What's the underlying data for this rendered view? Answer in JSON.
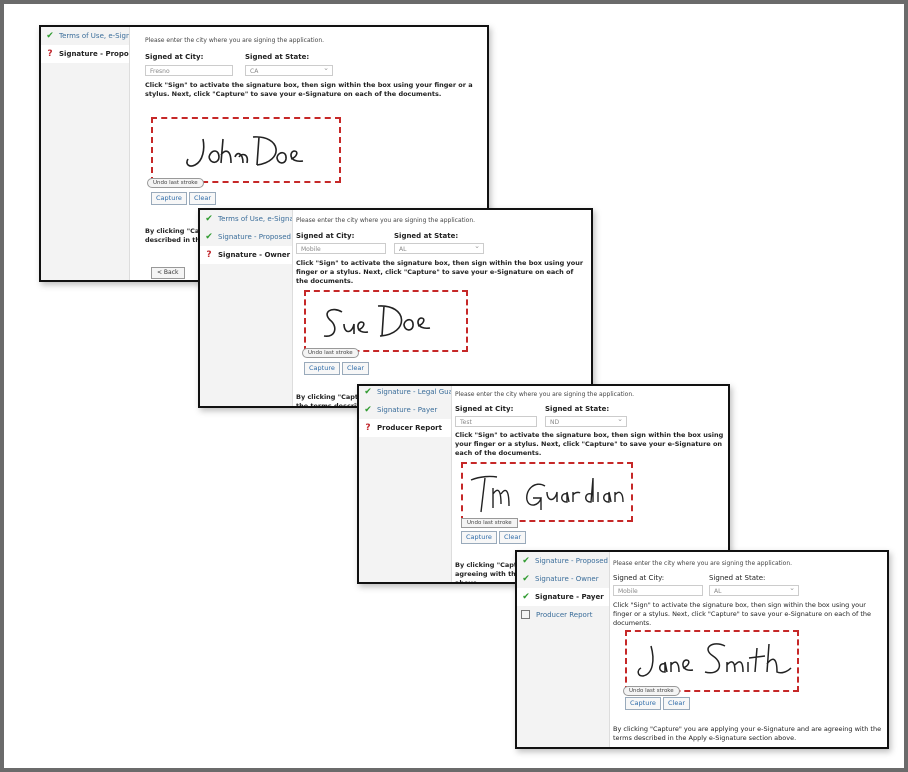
{
  "panel1": {
    "nav": [
      {
        "label": "Terms of Use, e-Signat...",
        "status": "done"
      },
      {
        "label": "Signature - Proposed I...",
        "status": "q"
      }
    ],
    "intro": "Please enter the city where you are signing the application.",
    "city_label": "Signed at City:",
    "city_value": "Fresno",
    "state_label": "Signed at State:",
    "state_value": "CA",
    "instructions": "Click \"Sign\" to activate the signature box, then sign within the box using your finger or a stylus. Next, click \"Capture\" to save your e-Signature on each of the documents.",
    "signature": "John Doe",
    "undo": "Undo last stroke",
    "capture": "Capture",
    "clear": "Clear",
    "consent": "By clicking \"Capture\" you are applying your e-Signature and are agreeing with the terms described in the Apply e-Signature section above.",
    "back": "< Back"
  },
  "panel2": {
    "nav": [
      {
        "label": "Terms of Use, e-Signat...",
        "status": "done"
      },
      {
        "label": "Signature - Proposed I...",
        "status": "done"
      },
      {
        "label": "Signature - Owner",
        "status": "q"
      }
    ],
    "intro": "Please enter the city where you are signing the application.",
    "city_label": "Signed at City:",
    "city_value": "Mobile",
    "state_label": "Signed at State:",
    "state_value": "AL",
    "instructions": "Click \"Sign\" to activate the signature box, then sign within the box using your finger or a stylus. Next, click \"Capture\" to save your e-Signature on each of the documents.",
    "signature": "Sue Doe",
    "undo": "Undo last stroke",
    "capture": "Capture",
    "clear": "Clear",
    "consent": "By clicking \"Capture\" you are applying your e-Signature and are agreeing with the terms described in the Apply e-Signature section above."
  },
  "panel3": {
    "nav": [
      {
        "label": "Signature - Legal Guar...",
        "status": "done"
      },
      {
        "label": "Signature - Payer",
        "status": "done"
      },
      {
        "label": "Producer Report",
        "status": "q"
      }
    ],
    "intro": "Please enter the city where you are signing the application.",
    "city_label": "Signed at City:",
    "city_value": "Test",
    "state_label": "Signed at State:",
    "state_value": "ND",
    "instructions": "Click \"Sign\" to activate the signature box, then sign within the box using your finger or a stylus. Next, click \"Capture\" to save your e-Signature on each of the documents.",
    "signature": "Tim Guardian",
    "undo": "Undo last stroke",
    "capture": "Capture",
    "clear": "Clear",
    "consent": "By clicking \"Capture\" you are applying your e-Signature and are agreeing with the terms described in the Apply e-Signature section above."
  },
  "panel4": {
    "nav": [
      {
        "label": "Signature - Proposed I...",
        "status": "done"
      },
      {
        "label": "Signature - Owner",
        "status": "done"
      },
      {
        "label": "Signature - Payer",
        "status": "done"
      },
      {
        "label": "Producer Report",
        "status": "empty"
      }
    ],
    "intro": "Please enter the city where you are signing the application.",
    "city_label": "Signed at City:",
    "city_value": "Mobile",
    "state_label": "Signed at State:",
    "state_value": "AL",
    "instructions": "Click \"Sign\" to activate the signature box, then sign within the box using your finger or a stylus. Next, click \"Capture\" to save your e-Signature on each of the documents.",
    "signature": "Jane Smith",
    "undo": "Undo last stroke",
    "capture": "Capture",
    "clear": "Clear",
    "consent": "By clicking \"Capture\" you are applying your e-Signature and are agreeing with the terms described in the Apply e-Signature section above."
  },
  "icons": {
    "done": "check-icon",
    "q": "question-icon",
    "empty": "checkbox-icon"
  },
  "colors": {
    "accent": "#3a6d9a",
    "check": "#2e9a2e",
    "question": "#c0272d",
    "sig_border": "#c62828",
    "frame": "#6b6b6b"
  }
}
